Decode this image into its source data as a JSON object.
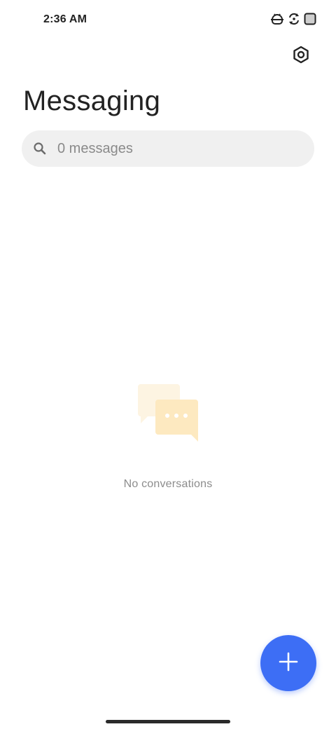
{
  "status_bar": {
    "time": "2:36 AM",
    "icons": [
      "android-debug-icon",
      "sync-icon",
      "battery-saver-icon"
    ]
  },
  "header": {
    "settings_icon": "settings-icon",
    "title": "Messaging"
  },
  "search": {
    "icon": "search-icon",
    "placeholder": "0 messages",
    "value": ""
  },
  "empty_state": {
    "icon": "chat-bubbles-icon",
    "text": "No conversations"
  },
  "fab": {
    "icon": "plus-icon",
    "color": "#3d6ef5"
  },
  "colors": {
    "accent": "#3d6ef5",
    "search_background": "#f0f0f0",
    "illustration_back": "#fdf4e2",
    "illustration_front": "#fde9c0"
  }
}
